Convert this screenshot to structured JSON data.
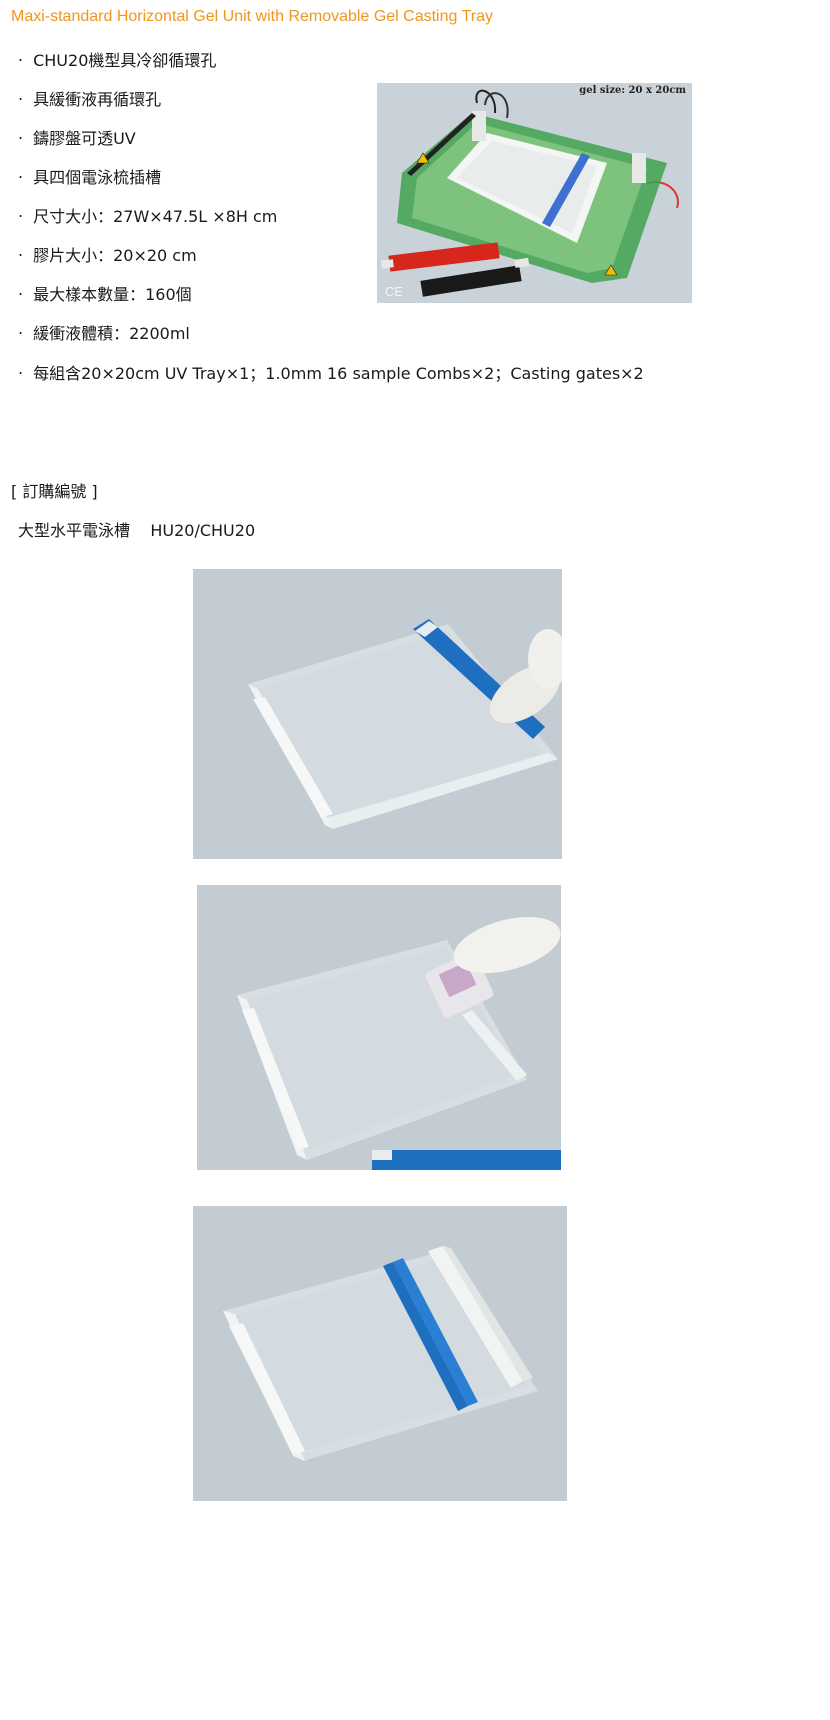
{
  "title": "Maxi-standard Horizontal Gel Unit with Removable Gel Casting Tray",
  "bullet_mark": "‧",
  "features": [
    "CHU20機型具冷卻循環孔",
    "具緩衝液再循環孔",
    "鑄膠盤可透UV",
    "具四個電泳梳插槽",
    "尺寸大小：27W×47.5L ×8H cm",
    "膠片大小：20×20 cm",
    "最大樣本數量：160個",
    "緩衝液體積：2200ml",
    "每組含20×20cm UV Tray×1；1.0mm 16 sample Combs×2；Casting gates×2"
  ],
  "ordering": {
    "heading": "[ 訂購編號 ]",
    "product_name": "大型水平電泳槽",
    "product_code": "HU20/CHU20"
  },
  "product_photo": {
    "gel_size_label": "gel size: 20 x 20cm",
    "ce_mark": "CE"
  },
  "colors": {
    "title": "#f0961e",
    "photo_background": "#c5d0d6",
    "comb_blue": "#1f6fc0",
    "unit_green": "#2e9a42",
    "comb_red": "#d7261c"
  }
}
